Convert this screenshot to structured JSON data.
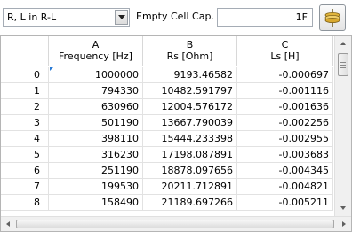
{
  "toolbar": {
    "mode_select": {
      "value": "R, L in R-L"
    },
    "empty_cell_cap_label": "Empty Cell Cap.",
    "empty_cell_cap_value": "1F",
    "cap_button_icon": "capacitor-icon"
  },
  "grid": {
    "columns": [
      {
        "letter": "A",
        "name": "Frequency [Hz]"
      },
      {
        "letter": "B",
        "name": "Rs [Ohm]"
      },
      {
        "letter": "C",
        "name": "Ls [H]"
      }
    ],
    "rows": [
      {
        "index": "0",
        "frequency": "1000000",
        "rs": "9193.46582",
        "ls": "-0.000697"
      },
      {
        "index": "1",
        "frequency": "794330",
        "rs": "10482.591797",
        "ls": "-0.001116"
      },
      {
        "index": "2",
        "frequency": "630960",
        "rs": "12004.576172",
        "ls": "-0.001636"
      },
      {
        "index": "3",
        "frequency": "501190",
        "rs": "13667.790039",
        "ls": "-0.002256"
      },
      {
        "index": "4",
        "frequency": "398110",
        "rs": "15444.233398",
        "ls": "-0.002955"
      },
      {
        "index": "5",
        "frequency": "316230",
        "rs": "17198.087891",
        "ls": "-0.003683"
      },
      {
        "index": "6",
        "frequency": "251190",
        "rs": "18878.097656",
        "ls": "-0.004345"
      },
      {
        "index": "7",
        "frequency": "199530",
        "rs": "20211.712891",
        "ls": "-0.004821"
      },
      {
        "index": "8",
        "frequency": "158490",
        "rs": "21189.697266",
        "ls": "-0.005211"
      }
    ]
  },
  "colors": {
    "selection_marker": "#2a7bd6",
    "grid_line": "#e2e2e2",
    "scrollbar_track": "#f0f0f0"
  }
}
